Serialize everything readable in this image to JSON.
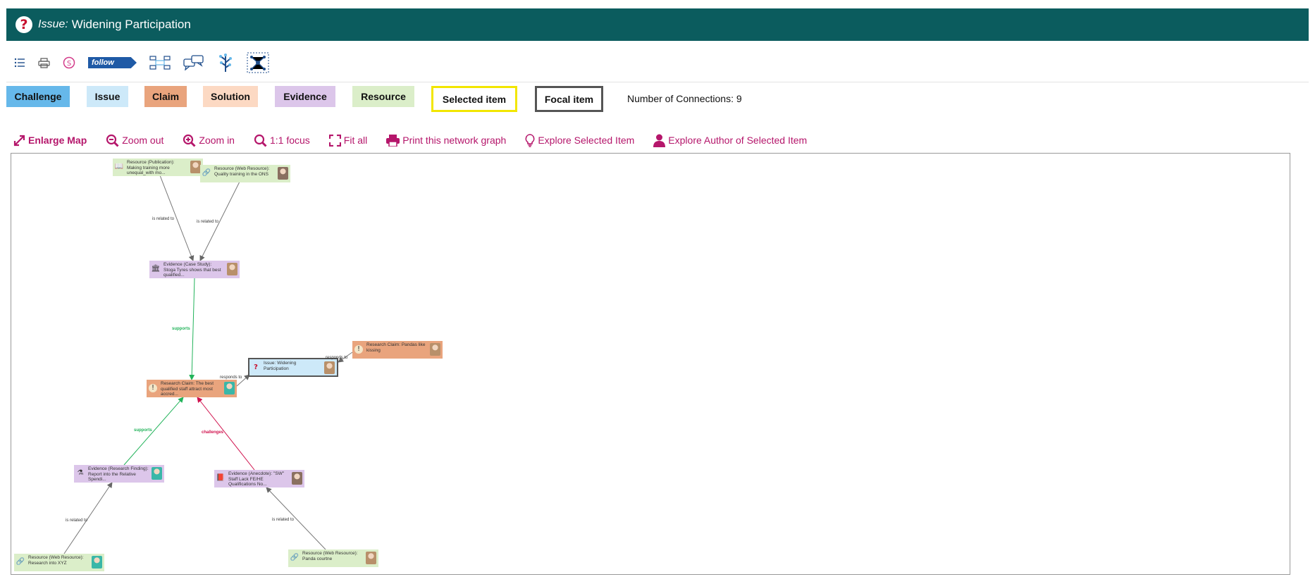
{
  "header": {
    "type_label": "Issue:",
    "title": "Widening Participation",
    "icon": "question-icon"
  },
  "toolbar": {
    "items": [
      {
        "name": "list-icon"
      },
      {
        "name": "print-icon"
      },
      {
        "name": "spam-icon"
      },
      {
        "name": "follow-button",
        "label": "follow"
      },
      {
        "name": "map-view-icon"
      },
      {
        "name": "discussion-icon"
      },
      {
        "name": "tree-view-icon"
      },
      {
        "name": "network-view-icon"
      }
    ]
  },
  "legend": {
    "challenge": "Challenge",
    "issue": "Issue",
    "claim": "Claim",
    "solution": "Solution",
    "evidence": "Evidence",
    "resource": "Resource",
    "selected": "Selected item",
    "focal": "Focal item"
  },
  "connections_text": "Number of Connections: 9",
  "actions": {
    "enlarge": "Enlarge Map",
    "zoom_out": "Zoom out",
    "zoom_in": "Zoom in",
    "focus": "1:1 focus",
    "fit_all": "Fit all",
    "print": "Print this network graph",
    "explore_item": "Explore Selected Item",
    "explore_author": "Explore Author of Selected Item"
  },
  "colors": {
    "header": "#0b5c5e",
    "challenge": "#66b8ea",
    "issue": "#cde9f9",
    "claim": "#e9a47d",
    "solution": "#fcd9c3",
    "evidence": "#dcc6ea",
    "resource": "#dbeec9",
    "selected_border": "#f2e600",
    "focal_border": "#555555",
    "action": "#b5166b",
    "supports": "#22b35a",
    "challenges": "#d0104c"
  },
  "graph": {
    "nodes": [
      {
        "id": "n1",
        "kind": "resource",
        "icon": "book-icon",
        "text": "Resource (Publication): Making training more unequal_with mo...",
        "avatar": "#b8906a"
      },
      {
        "id": "n2",
        "kind": "resource",
        "icon": "link-icon",
        "text": "Resource (Web Resource): Quality training in the ONS",
        "avatar": "#8a7060"
      },
      {
        "id": "n3",
        "kind": "evidence",
        "icon": "case-study-icon",
        "text": "Evidence (Case Study): Stoga Tyres shows that best qualified...",
        "avatar": "#b8906a"
      },
      {
        "id": "n4",
        "kind": "claim",
        "icon": "claim-icon",
        "text": "Research Claim: Pandas like kissing",
        "avatar": "#b8906a"
      },
      {
        "id": "n5",
        "kind": "issue",
        "icon": "issue-icon",
        "text": "Issue: Widening Participation",
        "avatar": "#b8906a"
      },
      {
        "id": "n6",
        "kind": "claim",
        "icon": "claim-icon",
        "text": "Research Claim: The best qualified staff attract most accred...",
        "avatar": "#3ab7a8"
      },
      {
        "id": "n7",
        "kind": "evidence",
        "icon": "research-icon",
        "text": "Evidence (Research Finding): Report into the Relative Spendi...",
        "avatar": "#3ab7a8"
      },
      {
        "id": "n8",
        "kind": "evidence",
        "icon": "anecdote-icon",
        "text": "Evidence (Anecdote): \"SW\" Staff Lack FE/HE Qualifications No...",
        "avatar": "#8a7060"
      },
      {
        "id": "n9",
        "kind": "resource",
        "icon": "link-icon",
        "text": "Resource (Web Resource): Research into XYZ",
        "avatar": "#3ab7a8"
      },
      {
        "id": "n10",
        "kind": "resource",
        "icon": "link-icon",
        "text": "Resource (Web Resource): Panda courtne",
        "avatar": "#b8906a"
      }
    ],
    "edges": [
      {
        "from": "n1",
        "to": "n3",
        "label": "is related to",
        "kind": "related"
      },
      {
        "from": "n2",
        "to": "n3",
        "label": "is related to",
        "kind": "related"
      },
      {
        "from": "n3",
        "to": "n6",
        "label": "supports",
        "kind": "supports"
      },
      {
        "from": "n4",
        "to": "n5",
        "label": "responds to",
        "kind": "related"
      },
      {
        "from": "n6",
        "to": "n5",
        "label": "responds to",
        "kind": "related"
      },
      {
        "from": "n7",
        "to": "n6",
        "label": "supports",
        "kind": "supports"
      },
      {
        "from": "n8",
        "to": "n6",
        "label": "challenges",
        "kind": "challenges"
      },
      {
        "from": "n9",
        "to": "n7",
        "label": "is related to",
        "kind": "related"
      },
      {
        "from": "n10",
        "to": "n8",
        "label": "is related to",
        "kind": "related"
      }
    ]
  }
}
